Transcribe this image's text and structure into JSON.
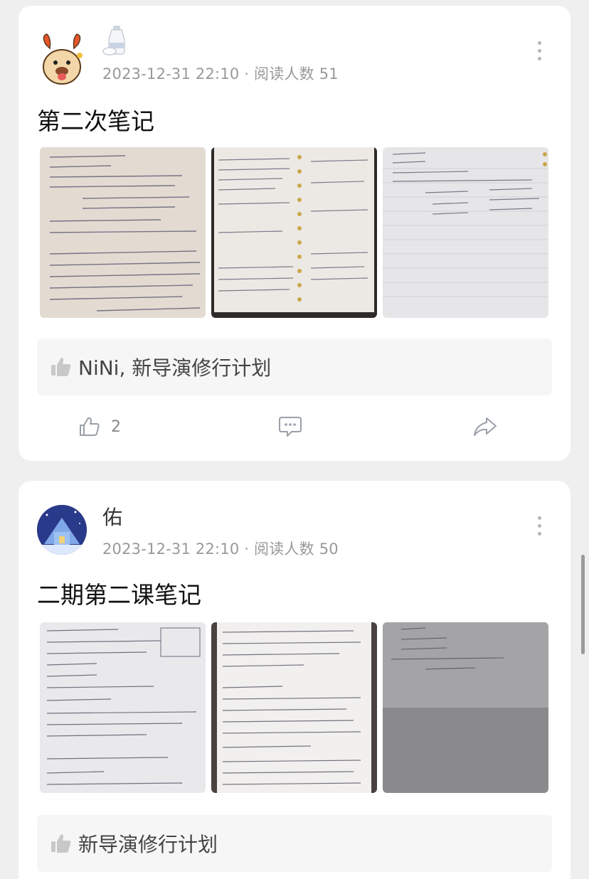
{
  "posts": [
    {
      "author": "",
      "meta": "2023-12-31 22:10 · 阅读人数 51",
      "title": "第二次笔记",
      "likers": "NiNi, 新导演修行计划",
      "like_count": "2",
      "avatar_icon": "cartoon-dog-avatar",
      "badge_icon": "sake-bottle-icon"
    },
    {
      "author": "佑",
      "meta": "2023-12-31 22:10 · 阅读人数 50",
      "title": "二期第二课笔记",
      "likers": "新导演修行计划",
      "avatar_icon": "snowy-cabin-avatar"
    }
  ],
  "colors": {
    "page_bg": "#efefef",
    "card_bg": "#ffffff",
    "meta_text": "#999999",
    "icon_gray": "#9aa0a8"
  }
}
